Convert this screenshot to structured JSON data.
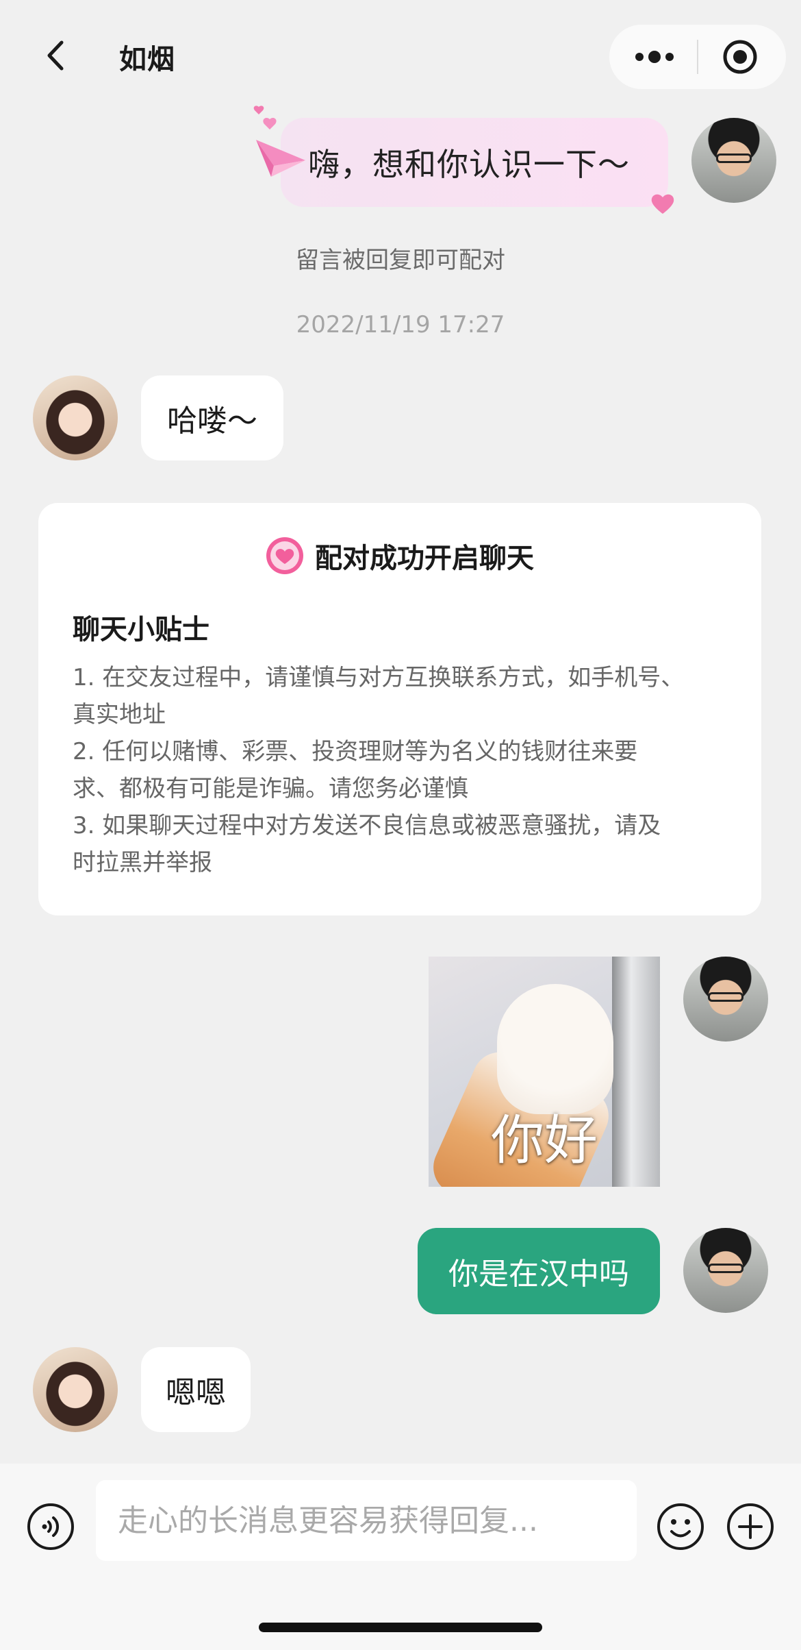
{
  "header": {
    "title": "如烟",
    "back_icon": "chevron-left-icon",
    "more_icon": "more-dots-icon",
    "target_icon": "record-target-icon"
  },
  "messages": {
    "greeting": "嗨，想和你认识一下～",
    "system_tip": "留言被回复即可配对",
    "timestamp": "2022/11/19 17:27",
    "her_hello": "哈喽～",
    "sticker_caption": "你好",
    "my_question": "你是在汉中吗",
    "her_reply": "嗯嗯"
  },
  "tips_card": {
    "heading": "配对成功开启聊天",
    "subtitle": "聊天小贴士",
    "lines": [
      "1. 在交友过程中，请谨慎与对方互换联系方式，如手机号、",
      "真实地址",
      "2. 任何以赌博、彩票、投资理财等为名义的钱财往来要",
      "求、都极有可能是诈骗。请您务必谨慎",
      "3. 如果聊天过程中对方发送不良信息或被恶意骚扰，请及",
      "时拉黑并举报"
    ]
  },
  "input_bar": {
    "placeholder": "走心的长消息更容易获得回复...",
    "voice_icon": "voice-icon",
    "emoji_icon": "emoji-icon",
    "plus_icon": "plus-icon"
  },
  "colors": {
    "background": "#f0f0f0",
    "accent_green": "#2aa57f",
    "greeting_pink": "#fbe0f3",
    "heart_pink": "#f06fa6"
  }
}
